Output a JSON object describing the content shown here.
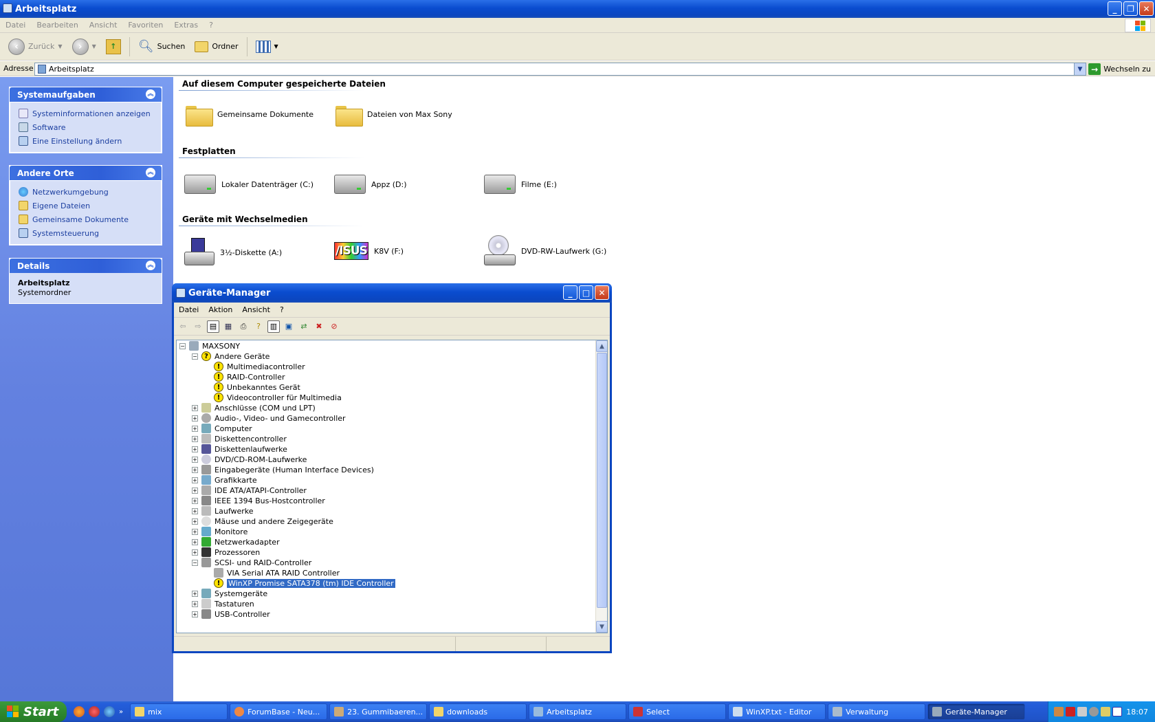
{
  "window": {
    "title": "Arbeitsplatz"
  },
  "menu": [
    "Datei",
    "Bearbeiten",
    "Ansicht",
    "Favoriten",
    "Extras",
    "?"
  ],
  "toolbar": {
    "back": "Zurück",
    "search": "Suchen",
    "folders": "Ordner"
  },
  "address": {
    "label": "Adresse",
    "value": "Arbeitsplatz",
    "go": "Wechseln zu"
  },
  "sidebar": {
    "system_tasks": {
      "title": "Systemaufgaben",
      "items": [
        "Systeminformationen anzeigen",
        "Software",
        "Eine Einstellung ändern"
      ]
    },
    "other_places": {
      "title": "Andere Orte",
      "items": [
        "Netzwerkumgebung",
        "Eigene Dateien",
        "Gemeinsame Dokumente",
        "Systemsteuerung"
      ]
    },
    "details": {
      "title": "Details",
      "name": "Arbeitsplatz",
      "type": "Systemordner"
    }
  },
  "content": {
    "sections": [
      {
        "title": "Auf diesem Computer gespeicherte Dateien",
        "items": [
          "Gemeinsame Dokumente",
          "Dateien von Max Sony"
        ]
      },
      {
        "title": "Festplatten",
        "items": [
          "Lokaler Datenträger (C:)",
          "Appz (D:)",
          "Filme (E:)"
        ]
      },
      {
        "title": "Geräte mit Wechselmedien",
        "items": [
          "3½-Diskette (A:)",
          "K8V (F:)",
          "DVD-RW-Laufwerk (G:)"
        ]
      }
    ]
  },
  "device_manager": {
    "title": "Geräte-Manager",
    "menu": [
      "Datei",
      "Aktion",
      "Ansicht",
      "?"
    ],
    "tree": {
      "root": "MAXSONY",
      "other_devices": {
        "label": "Andere Geräte",
        "children": [
          "Multimediacontroller",
          "RAID-Controller",
          "Unbekanntes Gerät",
          "Videocontroller für Multimedia"
        ]
      },
      "categories_a": [
        "Anschlüsse (COM und LPT)",
        "Audio-, Video- und Gamecontroller",
        "Computer",
        "Diskettencontroller",
        "Diskettenlaufwerke",
        "DVD/CD-ROM-Laufwerke",
        "Eingabegeräte (Human Interface Devices)",
        "Grafikkarte",
        "IDE ATA/ATAPI-Controller",
        "IEEE 1394 Bus-Hostcontroller",
        "Laufwerke",
        "Mäuse und andere Zeigegeräte",
        "Monitore",
        "Netzwerkadapter",
        "Prozessoren"
      ],
      "scsi": {
        "label": "SCSI- und RAID-Controller",
        "children": [
          "VIA Serial ATA RAID Controller",
          "WinXP Promise SATA378 (tm) IDE Controller"
        ]
      },
      "categories_b": [
        "Systemgeräte",
        "Tastaturen",
        "USB-Controller"
      ]
    }
  },
  "taskbar": {
    "start": "Start",
    "buttons": [
      "mix",
      "ForumBase - Neu...",
      "23. Gummibaeren...",
      "downloads",
      "Arbeitsplatz",
      "Select",
      "WinXP.txt - Editor",
      "Verwaltung",
      "Geräte-Manager"
    ],
    "clock": "18:07"
  }
}
